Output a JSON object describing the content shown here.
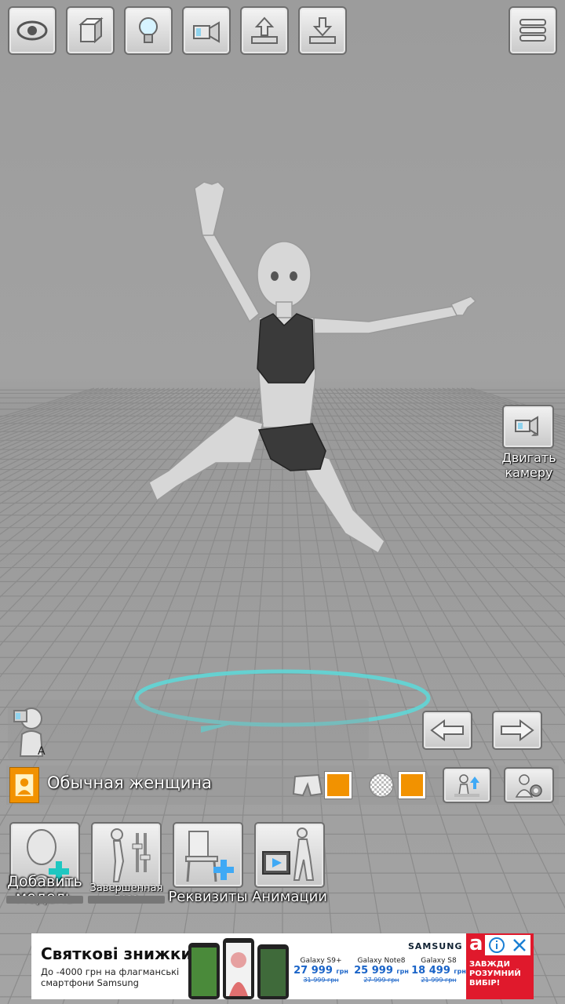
{
  "toolbar": {
    "buttons": [
      {
        "name": "view-button",
        "icon": "eye-icon"
      },
      {
        "name": "cube-button",
        "icon": "cube-icon"
      },
      {
        "name": "light-button",
        "icon": "lightbulb-icon"
      },
      {
        "name": "camera-button",
        "icon": "camera-icon"
      },
      {
        "name": "upload-button",
        "icon": "upload-icon"
      },
      {
        "name": "download-button",
        "icon": "download-icon"
      }
    ],
    "menu_icon": "menu-icon"
  },
  "camera_control": {
    "label": "Двигать камеру"
  },
  "model_bar": {
    "model_name": "Обычная женщина",
    "color_swatch_1": "#f29200",
    "color_swatch_2": "#f29200"
  },
  "bottom_buttons": {
    "add_model": "Добавить модель",
    "finished_pose": "Завершенная поза",
    "props": "Реквизиты",
    "animations": "Анимации"
  },
  "ad": {
    "title": "Святкові знижки",
    "subtitle_line1": "До -4000 грн на флагманські",
    "subtitle_line2": "смартфони Samsung",
    "brand": "SAMSUNG",
    "products": [
      {
        "name": "Galaxy S9+",
        "price": "27 999",
        "unit": "грн",
        "old": "31 999 грн"
      },
      {
        "name": "Galaxy Note8",
        "price": "25 999",
        "unit": "грн",
        "old": "27 999 грн"
      },
      {
        "name": "Galaxy S8",
        "price": "18 499",
        "unit": "грн",
        "old": "21 999 грн"
      }
    ],
    "store_letter": "a",
    "store_slogan": "ЗАВЖДИ РОЗУМНИЙ ВИБІР!"
  },
  "colors": {
    "accent": "#f29200",
    "ring": "#5fd6d6",
    "ad_red": "#e0192c"
  }
}
